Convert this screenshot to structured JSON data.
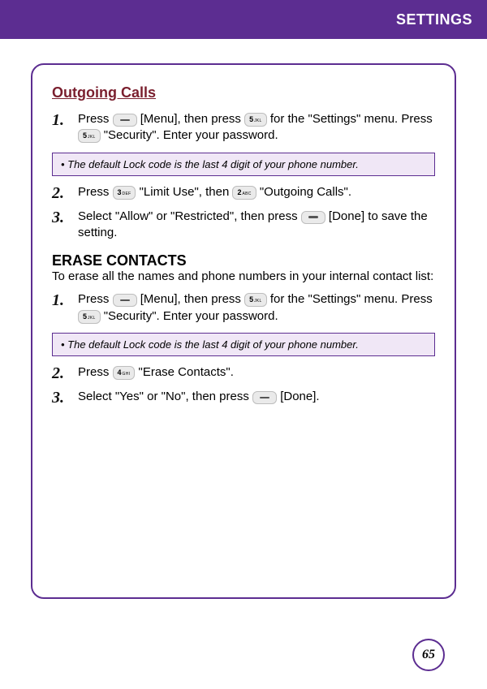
{
  "header": {
    "title": "SETTINGS"
  },
  "page_number": "65",
  "section1": {
    "heading": "Outgoing Calls",
    "step1a": "Press ",
    "step1b": " [Menu], then press ",
    "step1c": " for the \"Settings\" menu. Press ",
    "step1d": " \"Security\".  Enter your password.",
    "note": "• The default Lock code is the last 4 digit of your phone number.",
    "step2a": "Press ",
    "step2b": "  \"Limit Use\", then ",
    "step2c": "  \"Outgoing Calls\".",
    "step3a": "Select \"Allow\" or \"Restricted\", then press ",
    "step3b": " [Done] to save the setting."
  },
  "section2": {
    "heading": "ERASE CONTACTS",
    "desc": "To erase all the names and phone numbers in your internal contact list:",
    "step1a": "Press ",
    "step1b": " [Menu], then press ",
    "step1c": " for the \"Settings\" menu. Press ",
    "step1d": " \"Security\".  Enter your password.",
    "note": "• The default Lock code is the last 4 digit of your phone number.",
    "step2a": "Press ",
    "step2b": "  \"Erase Contacts\".",
    "step3a": "Select \"Yes\" or \"No\", then press ",
    "step3b": " [Done]."
  },
  "keys": {
    "k5n": "5",
    "k5l": "JKL",
    "k3n": "3",
    "k3l": "DEF",
    "k2n": "2",
    "k2l": "ABC",
    "k4n": "4",
    "k4l": "GHI"
  }
}
